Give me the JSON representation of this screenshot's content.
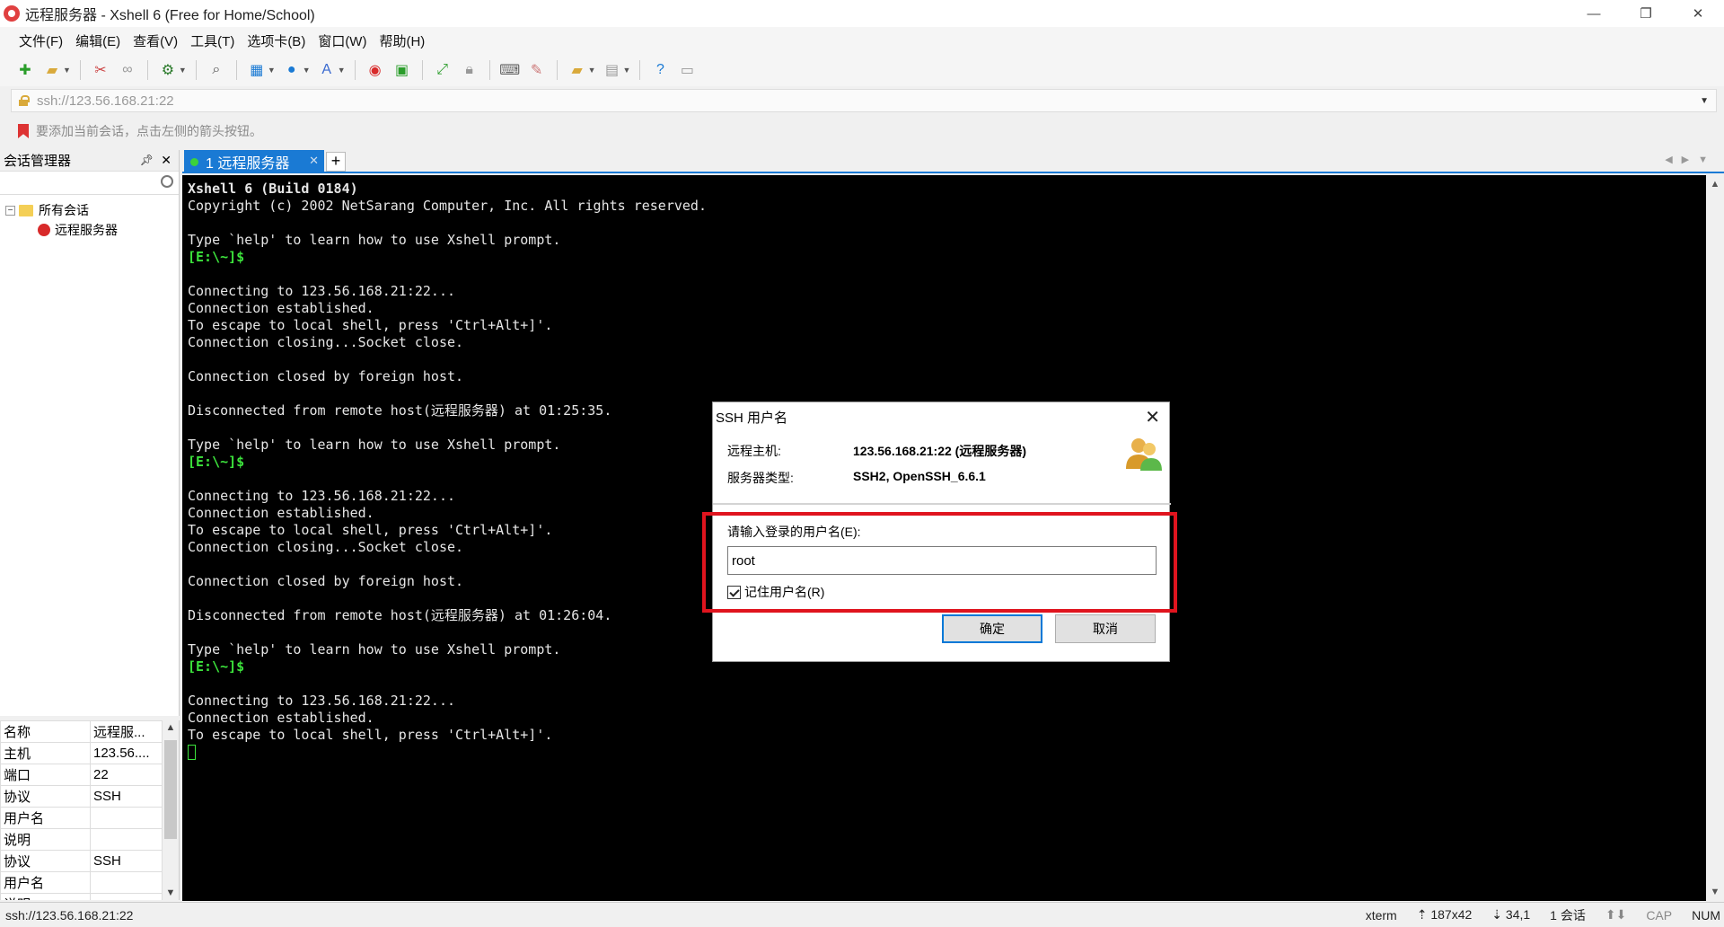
{
  "window": {
    "title": "远程服务器 - Xshell 6 (Free for Home/School)",
    "buttons": {
      "minimize": "—",
      "restore": "❐",
      "close": "✕"
    }
  },
  "menu": [
    "文件(F)",
    "编辑(E)",
    "查看(V)",
    "工具(T)",
    "选项卡(B)",
    "窗口(W)",
    "帮助(H)"
  ],
  "address": {
    "value": "ssh://123.56.168.21:22"
  },
  "hint": "要添加当前会话，点击左侧的箭头按钮。",
  "session_manager": {
    "title": "会话管理器",
    "tree": {
      "root": "所有会话",
      "child": "远程服务器"
    }
  },
  "properties": [
    {
      "k": "名称",
      "v": "远程服..."
    },
    {
      "k": "主机",
      "v": "123.56...."
    },
    {
      "k": "端口",
      "v": "22"
    },
    {
      "k": "协议",
      "v": "SSH"
    },
    {
      "k": "用户名",
      "v": ""
    },
    {
      "k": "说明",
      "v": ""
    },
    {
      "k": "协议",
      "v": "SSH"
    },
    {
      "k": "用户名",
      "v": ""
    },
    {
      "k": "说明",
      "v": ""
    }
  ],
  "tab": {
    "label": "1 远程服务器",
    "close": "✕",
    "add": "+"
  },
  "terminal": {
    "lines": [
      {
        "t": "Xshell 6 (Build 0184)",
        "s": "bold"
      },
      {
        "t": "Copyright (c) 2002 NetSarang Computer, Inc. All rights reserved.",
        "s": ""
      },
      {
        "t": "",
        "s": ""
      },
      {
        "t": "Type `help' to learn how to use Xshell prompt.",
        "s": ""
      },
      {
        "t": "[E:\\~]$",
        "s": "prompt"
      },
      {
        "t": "",
        "s": ""
      },
      {
        "t": "Connecting to 123.56.168.21:22...",
        "s": ""
      },
      {
        "t": "Connection established.",
        "s": ""
      },
      {
        "t": "To escape to local shell, press 'Ctrl+Alt+]'.",
        "s": ""
      },
      {
        "t": "Connection closing...Socket close.",
        "s": ""
      },
      {
        "t": "",
        "s": ""
      },
      {
        "t": "Connection closed by foreign host.",
        "s": ""
      },
      {
        "t": "",
        "s": ""
      },
      {
        "t": "Disconnected from remote host(远程服务器) at 01:25:35.",
        "s": ""
      },
      {
        "t": "",
        "s": ""
      },
      {
        "t": "Type `help' to learn how to use Xshell prompt.",
        "s": ""
      },
      {
        "t": "[E:\\~]$",
        "s": "prompt"
      },
      {
        "t": "",
        "s": ""
      },
      {
        "t": "Connecting to 123.56.168.21:22...",
        "s": ""
      },
      {
        "t": "Connection established.",
        "s": ""
      },
      {
        "t": "To escape to local shell, press 'Ctrl+Alt+]'.",
        "s": ""
      },
      {
        "t": "Connection closing...Socket close.",
        "s": ""
      },
      {
        "t": "",
        "s": ""
      },
      {
        "t": "Connection closed by foreign host.",
        "s": ""
      },
      {
        "t": "",
        "s": ""
      },
      {
        "t": "Disconnected from remote host(远程服务器) at 01:26:04.",
        "s": ""
      },
      {
        "t": "",
        "s": ""
      },
      {
        "t": "Type `help' to learn how to use Xshell prompt.",
        "s": ""
      },
      {
        "t": "[E:\\~]$",
        "s": "prompt"
      },
      {
        "t": "",
        "s": ""
      },
      {
        "t": "Connecting to 123.56.168.21:22...",
        "s": ""
      },
      {
        "t": "Connection established.",
        "s": ""
      },
      {
        "t": "To escape to local shell, press 'Ctrl+Alt+]'.",
        "s": ""
      }
    ]
  },
  "dialog": {
    "title": "SSH 用户名",
    "remote_host_label": "远程主机:",
    "remote_host_value": "123.56.168.21:22 (远程服务器)",
    "server_type_label": "服务器类型:",
    "server_type_value": "SSH2, OpenSSH_6.6.1",
    "username_label": "请输入登录的用户名(E):",
    "username_value": "root",
    "remember_label": "记住用户名(R)",
    "ok_label": "确定",
    "cancel_label": "取消"
  },
  "status": {
    "left": "ssh://123.56.168.21:22",
    "term": "xterm",
    "size": "187x42",
    "pos": "34,1",
    "sessions": "1 会话",
    "cap": "CAP",
    "num": "NUM"
  },
  "colors": {
    "accent": "#1a7ad4",
    "prompt": "#3ce23c",
    "highlight": "#e0141e"
  }
}
